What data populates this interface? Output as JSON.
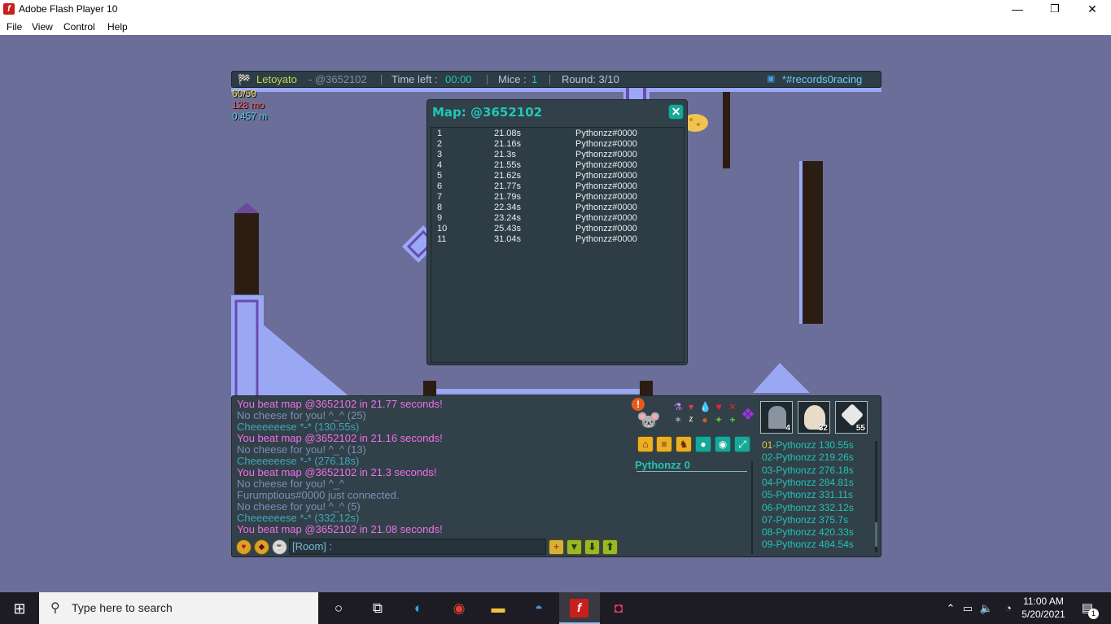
{
  "window": {
    "title": "Adobe Flash Player 10",
    "app_icon": "flash-icon",
    "controls": {
      "minimize": "—",
      "maximize": "❐",
      "close": "✕"
    }
  },
  "menubar": [
    "File",
    "View",
    "Control",
    "Help"
  ],
  "hud": {
    "player": "Letoyato",
    "map_code": "- @3652102",
    "time_left_label": "Time left :",
    "time_left_value": "00:00",
    "mice_label": "Mice :",
    "mice_value": "1",
    "round": "Round: 3/10",
    "room": "*#records0racing",
    "stats": [
      "60/59",
      "128 mo",
      "0.457 m"
    ]
  },
  "map_panel": {
    "title": "Map: @3652102",
    "close": "✕",
    "records": [
      {
        "rank": "1",
        "time": "21.08s",
        "player": "Pythonzz#0000"
      },
      {
        "rank": "2",
        "time": "21.16s",
        "player": "Pythonzz#0000"
      },
      {
        "rank": "3",
        "time": "21.3s",
        "player": "Pythonzz#0000"
      },
      {
        "rank": "4",
        "time": "21.55s",
        "player": "Pythonzz#0000"
      },
      {
        "rank": "5",
        "time": "21.62s",
        "player": "Pythonzz#0000"
      },
      {
        "rank": "6",
        "time": "21.77s",
        "player": "Pythonzz#0000"
      },
      {
        "rank": "7",
        "time": "21.79s",
        "player": "Pythonzz#0000"
      },
      {
        "rank": "8",
        "time": "22.34s",
        "player": "Pythonzz#0000"
      },
      {
        "rank": "9",
        "time": "23.24s",
        "player": "Pythonzz#0000"
      },
      {
        "rank": "10",
        "time": "25.43s",
        "player": "Pythonzz#0000"
      },
      {
        "rank": "11",
        "time": "31.04s",
        "player": "Pythonzz#0000"
      }
    ]
  },
  "chat": {
    "lines": [
      {
        "text": "You beat map @3652102 in 21.77 seconds!",
        "color": "#f070e8"
      },
      {
        "text": "No cheese for you! ^_^ (25)",
        "color": "#7a90b8"
      },
      {
        "text": "Cheeeeeese *-* (130.55s)",
        "color": "#3fa8b8"
      },
      {
        "text": "You beat map @3652102 in 21.16 seconds!",
        "color": "#f070e8"
      },
      {
        "text": "No cheese for you! ^_^ (13)",
        "color": "#7a90b8"
      },
      {
        "text": "Cheeeeeese *-* (276.18s)",
        "color": "#3fa8b8"
      },
      {
        "text": "You beat map @3652102 in 21.3 seconds!",
        "color": "#f070e8"
      },
      {
        "text": "No cheese for you! ^_^",
        "color": "#7a90b8"
      },
      {
        "text": "Furumptious#0000 just connected.",
        "color": "#7a90b8"
      },
      {
        "text": "No cheese for you! ^_^ (5)",
        "color": "#7a90b8"
      },
      {
        "text": "Cheeeeeese *-* (332.12s)",
        "color": "#3fa8b8"
      },
      {
        "text": "You beat map @3652102 in 21.08 seconds!",
        "color": "#f070e8"
      }
    ],
    "input_value": "[Room] :"
  },
  "player_panel": {
    "name": "Pythonzz",
    "score": "0",
    "avatars": [
      {
        "icon": "tombstone-icon",
        "count": "4"
      },
      {
        "icon": "mouse-portrait-icon",
        "count": "32"
      },
      {
        "icon": "axe-icon",
        "count": "55"
      }
    ],
    "ranking": [
      {
        "num": "01",
        "text": "-Pythonzz 130.55s"
      },
      {
        "num": "02",
        "text": "-Pythonzz 219.26s"
      },
      {
        "num": "03",
        "text": "-Pythonzz 276.18s"
      },
      {
        "num": "04",
        "text": "-Pythonzz 284.81s"
      },
      {
        "num": "05",
        "text": "-Pythonzz 331.11s"
      },
      {
        "num": "06",
        "text": "-Pythonzz 332.12s"
      },
      {
        "num": "07",
        "text": "-Pythonzz 375.7s"
      },
      {
        "num": "08",
        "text": "-Pythonzz 420.33s"
      },
      {
        "num": "09",
        "text": "-Pythonzz 484.54s"
      }
    ],
    "menu_buttons": [
      "home-icon",
      "list-icon",
      "shop-icon",
      "chat-bubble-icon",
      "discord-icon",
      "fullscreen-icon"
    ]
  },
  "taskbar": {
    "search_placeholder": "Type here to search",
    "time": "11:00 AM",
    "date": "5/20/2021",
    "notification_count": "1"
  },
  "colors": {
    "stage": "#6a6e98",
    "panel": "#324049",
    "accent_teal": "#20c8b8",
    "pink_msg": "#f070e8"
  }
}
